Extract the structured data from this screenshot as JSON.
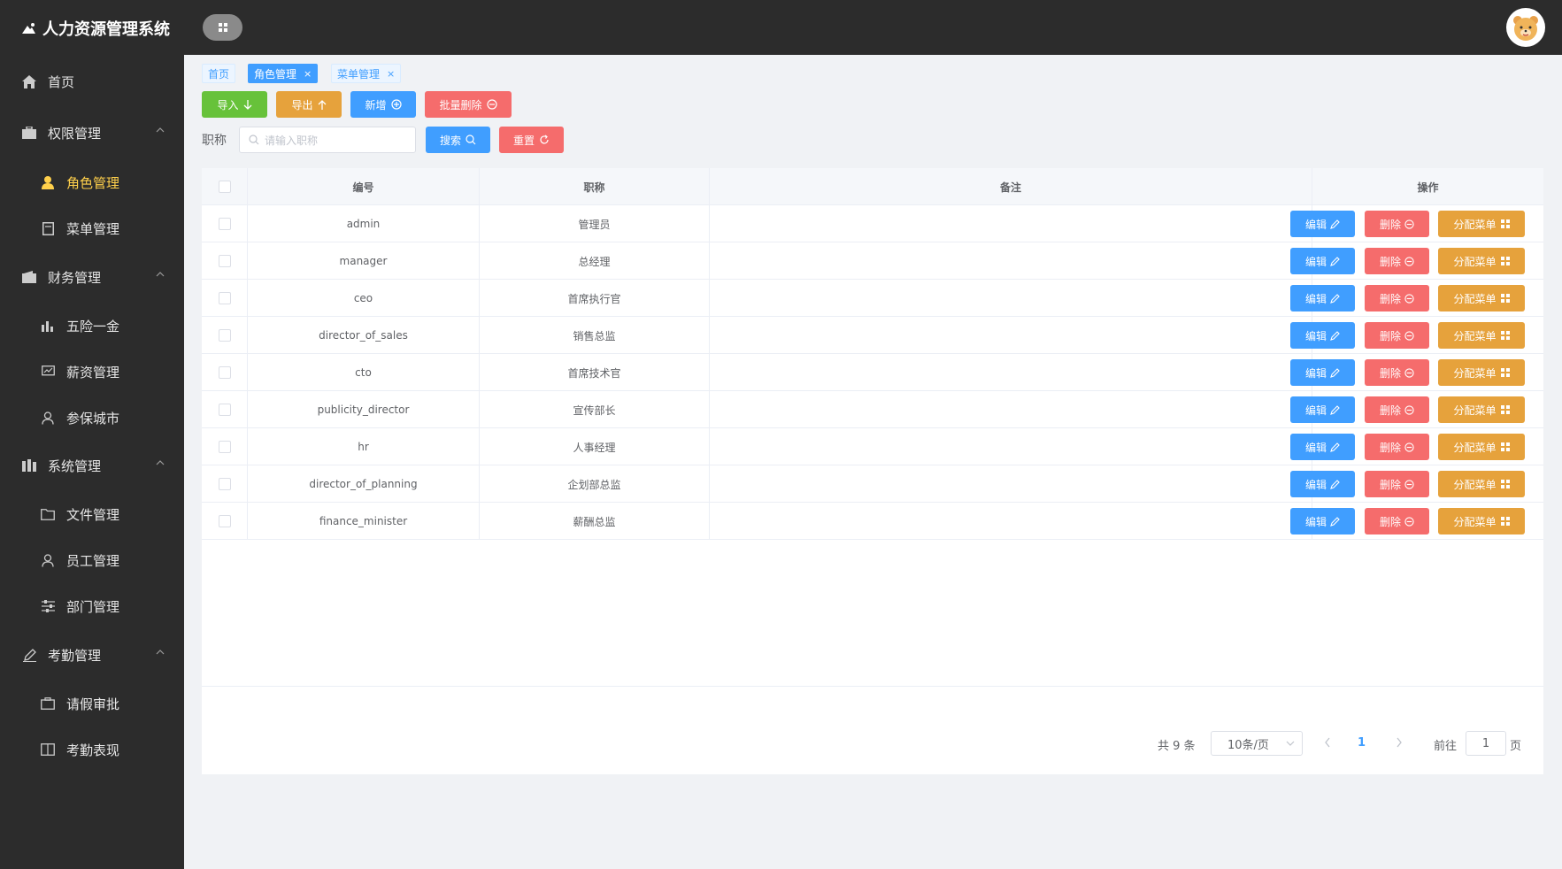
{
  "app": {
    "title": "人力资源管理系统"
  },
  "sidebar": {
    "home": "首页",
    "groups": [
      {
        "label": "权限管理",
        "items": [
          "角色管理",
          "菜单管理"
        ]
      },
      {
        "label": "财务管理",
        "items": [
          "五险一金",
          "薪资管理",
          "参保城市"
        ]
      },
      {
        "label": "系统管理",
        "items": [
          "文件管理",
          "员工管理",
          "部门管理"
        ]
      },
      {
        "label": "考勤管理",
        "items": [
          "请假审批",
          "考勤表现"
        ]
      }
    ],
    "active_item": "角色管理",
    "active_color": "#ffd04b"
  },
  "tags": [
    {
      "label": "首页",
      "closable": false
    },
    {
      "label": "角色管理",
      "closable": true,
      "active": true
    },
    {
      "label": "菜单管理",
      "closable": true
    }
  ],
  "toolbar": {
    "import_label": "导入",
    "export_label": "导出",
    "add_label": "新增",
    "batch_delete_label": "批量删除"
  },
  "search": {
    "label": "职称",
    "placeholder": "请输入职称",
    "search_label": "搜索",
    "reset_label": "重置"
  },
  "table": {
    "columns": [
      "编号",
      "职称",
      "备注",
      "操作"
    ],
    "rows": [
      {
        "code": "admin",
        "title": "管理员",
        "note": ""
      },
      {
        "code": "manager",
        "title": "总经理",
        "note": ""
      },
      {
        "code": "ceo",
        "title": "首席执行官",
        "note": ""
      },
      {
        "code": "director_of_sales",
        "title": "销售总监",
        "note": ""
      },
      {
        "code": "cto",
        "title": "首席技术官",
        "note": ""
      },
      {
        "code": "publicity_director",
        "title": "宣传部长",
        "note": ""
      },
      {
        "code": "hr",
        "title": "人事经理",
        "note": ""
      },
      {
        "code": "director_of_planning",
        "title": "企划部总监",
        "note": ""
      },
      {
        "code": "finance_minister",
        "title": "薪酬总监",
        "note": ""
      }
    ],
    "actions": {
      "edit": "编辑",
      "delete": "删除",
      "assign": "分配菜单"
    }
  },
  "pagination": {
    "total_text": "共 9 条",
    "page_size": "10条/页",
    "current_page": "1",
    "goto_label": "前往",
    "goto_value": "1",
    "page_suffix": "页"
  },
  "colors": {
    "primary": "#409eff",
    "success": "#67c23a",
    "warning": "#e6a23c",
    "danger": "#f56c6c",
    "header_bg": "#2c2c2c",
    "sidebar_bg": "#2c2c2c"
  }
}
